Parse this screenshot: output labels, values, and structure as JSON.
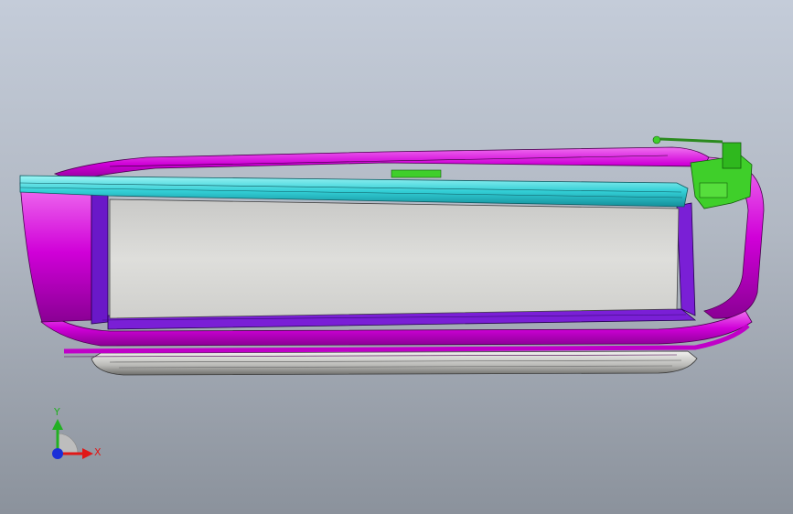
{
  "viewport": {
    "background_top": "#c4ccd9",
    "background_bottom": "#8b929c"
  },
  "model": {
    "parts": [
      {
        "name": "outer-frame",
        "color": "#e000e0"
      },
      {
        "name": "inner-frame",
        "color": "#7a1fd6"
      },
      {
        "name": "top-rail",
        "color": "#39d9d9"
      },
      {
        "name": "panel",
        "color": "#d8d8d5"
      },
      {
        "name": "bracket-assembly",
        "color": "#3fcf2a"
      },
      {
        "name": "runner",
        "color": "#c9c9c6"
      }
    ]
  },
  "triad": {
    "x_label": "X",
    "y_label": "Y",
    "x_color": "#e01818",
    "y_color": "#22b022",
    "z_color": "#1a2fd8"
  }
}
